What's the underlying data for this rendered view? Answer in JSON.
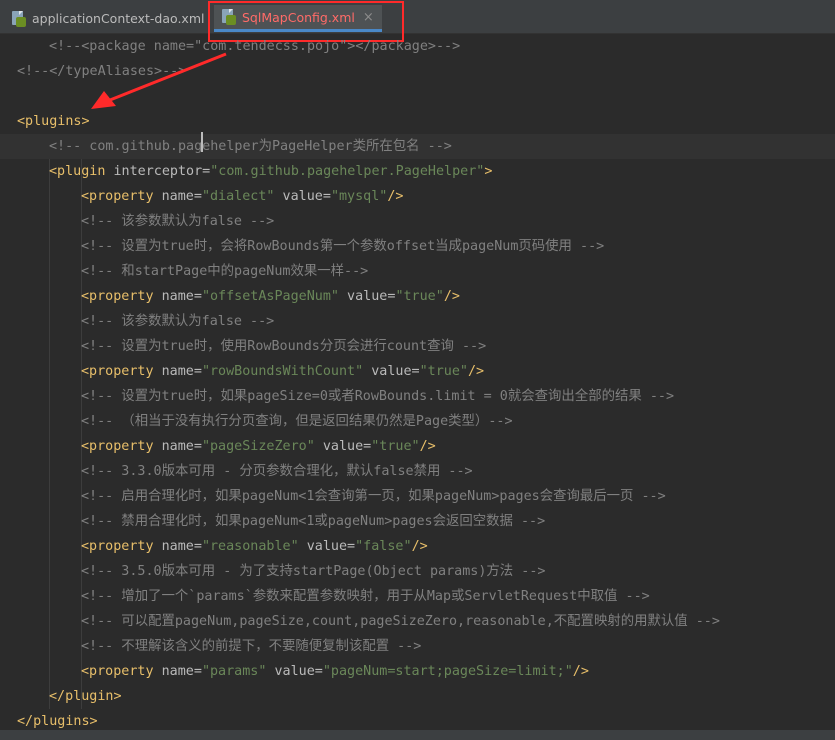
{
  "tabs": [
    {
      "label": "applicationContext-dao.xml",
      "active": false
    },
    {
      "label": "SqlMapConfig.xml",
      "active": true
    }
  ],
  "close_glyph": "×",
  "annotation_color": "#ff2a2a",
  "code": [
    {
      "indent": 1,
      "parts": [
        [
          "c",
          "<!--<package name=\"com.tendecss.pojo\"></package>-->"
        ]
      ]
    },
    {
      "indent": 0,
      "parts": [
        [
          "c",
          "<!--</typeAliases>-->"
        ]
      ]
    },
    {
      "indent": 0,
      "parts": []
    },
    {
      "indent": 0,
      "parts": [
        [
          "t",
          "<plugins>"
        ]
      ]
    },
    {
      "indent": 1,
      "current": true,
      "parts": [
        [
          "c",
          "<!-- com.github.pagehelper为PageHelper类所在包名 -->"
        ]
      ]
    },
    {
      "indent": 1,
      "parts": [
        [
          "t",
          "<plugin "
        ],
        [
          "a",
          "interceptor="
        ],
        [
          "v",
          "\"com.github.pagehelper.PageHelper\""
        ],
        [
          "t",
          ">"
        ]
      ]
    },
    {
      "indent": 2,
      "parts": [
        [
          "t",
          "<property "
        ],
        [
          "a",
          "name="
        ],
        [
          "v",
          "\"dialect\""
        ],
        [
          "a",
          " value="
        ],
        [
          "v",
          "\"mysql\""
        ],
        [
          "t",
          "/>"
        ]
      ]
    },
    {
      "indent": 2,
      "parts": [
        [
          "c",
          "<!-- 该参数默认为false -->"
        ]
      ]
    },
    {
      "indent": 2,
      "parts": [
        [
          "c",
          "<!-- 设置为true时，会将RowBounds第一个参数offset当成pageNum页码使用 -->"
        ]
      ]
    },
    {
      "indent": 2,
      "parts": [
        [
          "c",
          "<!-- 和startPage中的pageNum效果一样-->"
        ]
      ]
    },
    {
      "indent": 2,
      "parts": [
        [
          "t",
          "<property "
        ],
        [
          "a",
          "name="
        ],
        [
          "v",
          "\"offsetAsPageNum\""
        ],
        [
          "a",
          " value="
        ],
        [
          "v",
          "\"true\""
        ],
        [
          "t",
          "/>"
        ]
      ]
    },
    {
      "indent": 2,
      "parts": [
        [
          "c",
          "<!-- 该参数默认为false -->"
        ]
      ]
    },
    {
      "indent": 2,
      "parts": [
        [
          "c",
          "<!-- 设置为true时，使用RowBounds分页会进行count查询 -->"
        ]
      ]
    },
    {
      "indent": 2,
      "parts": [
        [
          "t",
          "<property "
        ],
        [
          "a",
          "name="
        ],
        [
          "v",
          "\"rowBoundsWithCount\""
        ],
        [
          "a",
          " value="
        ],
        [
          "v",
          "\"true\""
        ],
        [
          "t",
          "/>"
        ]
      ]
    },
    {
      "indent": 2,
      "parts": [
        [
          "c",
          "<!-- 设置为true时，如果pageSize=0或者RowBounds.limit = 0就会查询出全部的结果 -->"
        ]
      ]
    },
    {
      "indent": 2,
      "parts": [
        [
          "c",
          "<!-- （相当于没有执行分页查询，但是返回结果仍然是Page类型）-->"
        ]
      ]
    },
    {
      "indent": 2,
      "parts": [
        [
          "t",
          "<property "
        ],
        [
          "a",
          "name="
        ],
        [
          "v",
          "\"pageSizeZero\""
        ],
        [
          "a",
          " value="
        ],
        [
          "v",
          "\"true\""
        ],
        [
          "t",
          "/>"
        ]
      ]
    },
    {
      "indent": 2,
      "parts": [
        [
          "c",
          "<!-- 3.3.0版本可用 - 分页参数合理化，默认false禁用 -->"
        ]
      ]
    },
    {
      "indent": 2,
      "parts": [
        [
          "c",
          "<!-- 启用合理化时，如果pageNum<1会查询第一页，如果pageNum>pages会查询最后一页 -->"
        ]
      ]
    },
    {
      "indent": 2,
      "parts": [
        [
          "c",
          "<!-- 禁用合理化时，如果pageNum<1或pageNum>pages会返回空数据 -->"
        ]
      ]
    },
    {
      "indent": 2,
      "parts": [
        [
          "t",
          "<property "
        ],
        [
          "a",
          "name="
        ],
        [
          "v",
          "\"reasonable\""
        ],
        [
          "a",
          " value="
        ],
        [
          "v",
          "\"false\""
        ],
        [
          "t",
          "/>"
        ]
      ]
    },
    {
      "indent": 2,
      "parts": [
        [
          "c",
          "<!-- 3.5.0版本可用 - 为了支持startPage(Object params)方法 -->"
        ]
      ]
    },
    {
      "indent": 2,
      "parts": [
        [
          "c",
          "<!-- 增加了一个`params`参数来配置参数映射，用于从Map或ServletRequest中取值 -->"
        ]
      ]
    },
    {
      "indent": 2,
      "parts": [
        [
          "c",
          "<!-- 可以配置pageNum,pageSize,count,pageSizeZero,reasonable,不配置映射的用默认值 -->"
        ]
      ]
    },
    {
      "indent": 2,
      "parts": [
        [
          "c",
          "<!-- 不理解该含义的前提下，不要随便复制该配置 -->"
        ]
      ]
    },
    {
      "indent": 2,
      "parts": [
        [
          "t",
          "<property "
        ],
        [
          "a",
          "name="
        ],
        [
          "v",
          "\"params\""
        ],
        [
          "a",
          " value="
        ],
        [
          "v",
          "\"pageNum=start;pageSize=limit;\""
        ],
        [
          "t",
          "/>"
        ]
      ]
    },
    {
      "indent": 1,
      "parts": [
        [
          "t",
          "</plugin>"
        ]
      ]
    },
    {
      "indent": 0,
      "parts": [
        [
          "t",
          "</plugins>"
        ]
      ]
    }
  ]
}
